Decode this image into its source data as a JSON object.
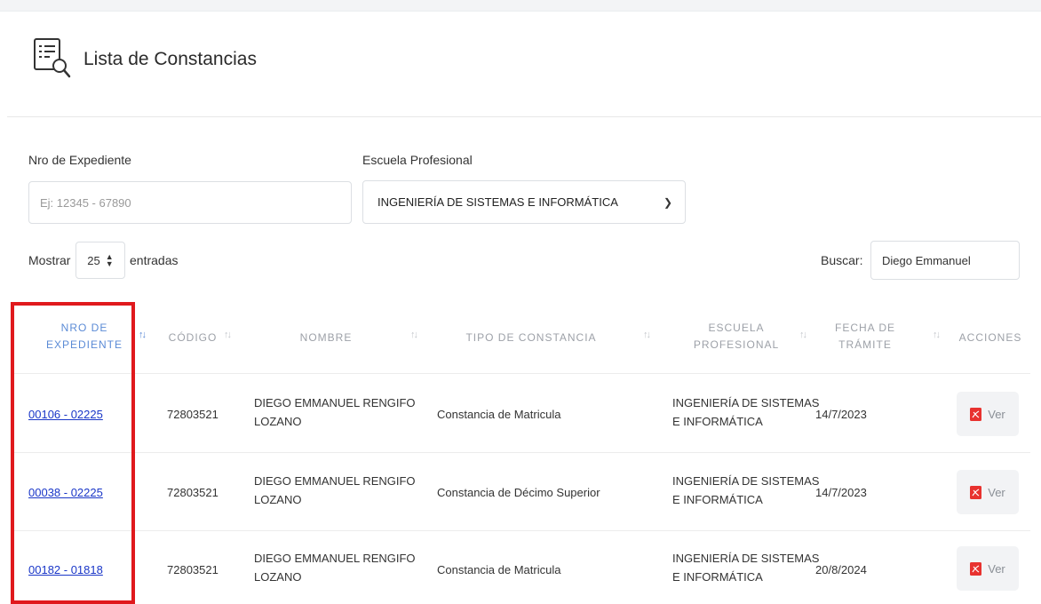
{
  "header": {
    "title": "Lista de Constancias",
    "icon": "list-search-icon"
  },
  "filters": {
    "expediente_label": "Nro de Expediente",
    "expediente_placeholder": "Ej: 12345 - 67890",
    "escuela_label": "Escuela Profesional",
    "escuela_selected": "INGENIERÍA DE SISTEMAS E INFORMÁTICA"
  },
  "table_controls": {
    "show_label": "Mostrar",
    "entries_value": "25",
    "entries_label": "entradas",
    "search_label": "Buscar:",
    "search_value": "Diego Emmanuel"
  },
  "table": {
    "headers": {
      "expediente_1": "NRO DE",
      "expediente_2": "EXPEDIENTE",
      "codigo": "CÓDIGO",
      "nombre": "NOMBRE",
      "tipo": "TIPO DE CONSTANCIA",
      "escuela_1": "ESCUELA",
      "escuela_2": "PROFESIONAL",
      "fecha_1": "FECHA DE",
      "fecha_2": "TRÁMITE",
      "acciones": "ACCIONES"
    },
    "rows": [
      {
        "expediente": "00106 - 02225",
        "codigo": "72803521",
        "nombre_1": "DIEGO EMMANUEL RENGIFO",
        "nombre_2": "LOZANO",
        "tipo": "Constancia de Matricula",
        "escuela_1": "INGENIERÍA DE SISTEMAS",
        "escuela_2": "E INFORMÁTICA",
        "fecha": "14/7/2023",
        "accion": "Ver"
      },
      {
        "expediente": "00038 - 02225",
        "codigo": "72803521",
        "nombre_1": "DIEGO EMMANUEL RENGIFO",
        "nombre_2": "LOZANO",
        "tipo": "Constancia de Décimo Superior",
        "escuela_1": "INGENIERÍA DE SISTEMAS",
        "escuela_2": "E INFORMÁTICA",
        "fecha": "14/7/2023",
        "accion": "Ver"
      },
      {
        "expediente": "00182 - 01818",
        "codigo": "72803521",
        "nombre_1": "DIEGO EMMANUEL RENGIFO",
        "nombre_2": "LOZANO",
        "tipo": "Constancia de Matricula",
        "escuela_1": "INGENIERÍA DE SISTEMAS",
        "escuela_2": "E INFORMÁTICA",
        "fecha": "20/8/2024",
        "accion": "Ver"
      }
    ]
  },
  "colors": {
    "link": "#1a37c8",
    "highlight": "#e0191d",
    "pdf": "#e8322f",
    "active_header": "#5b8bd6"
  }
}
